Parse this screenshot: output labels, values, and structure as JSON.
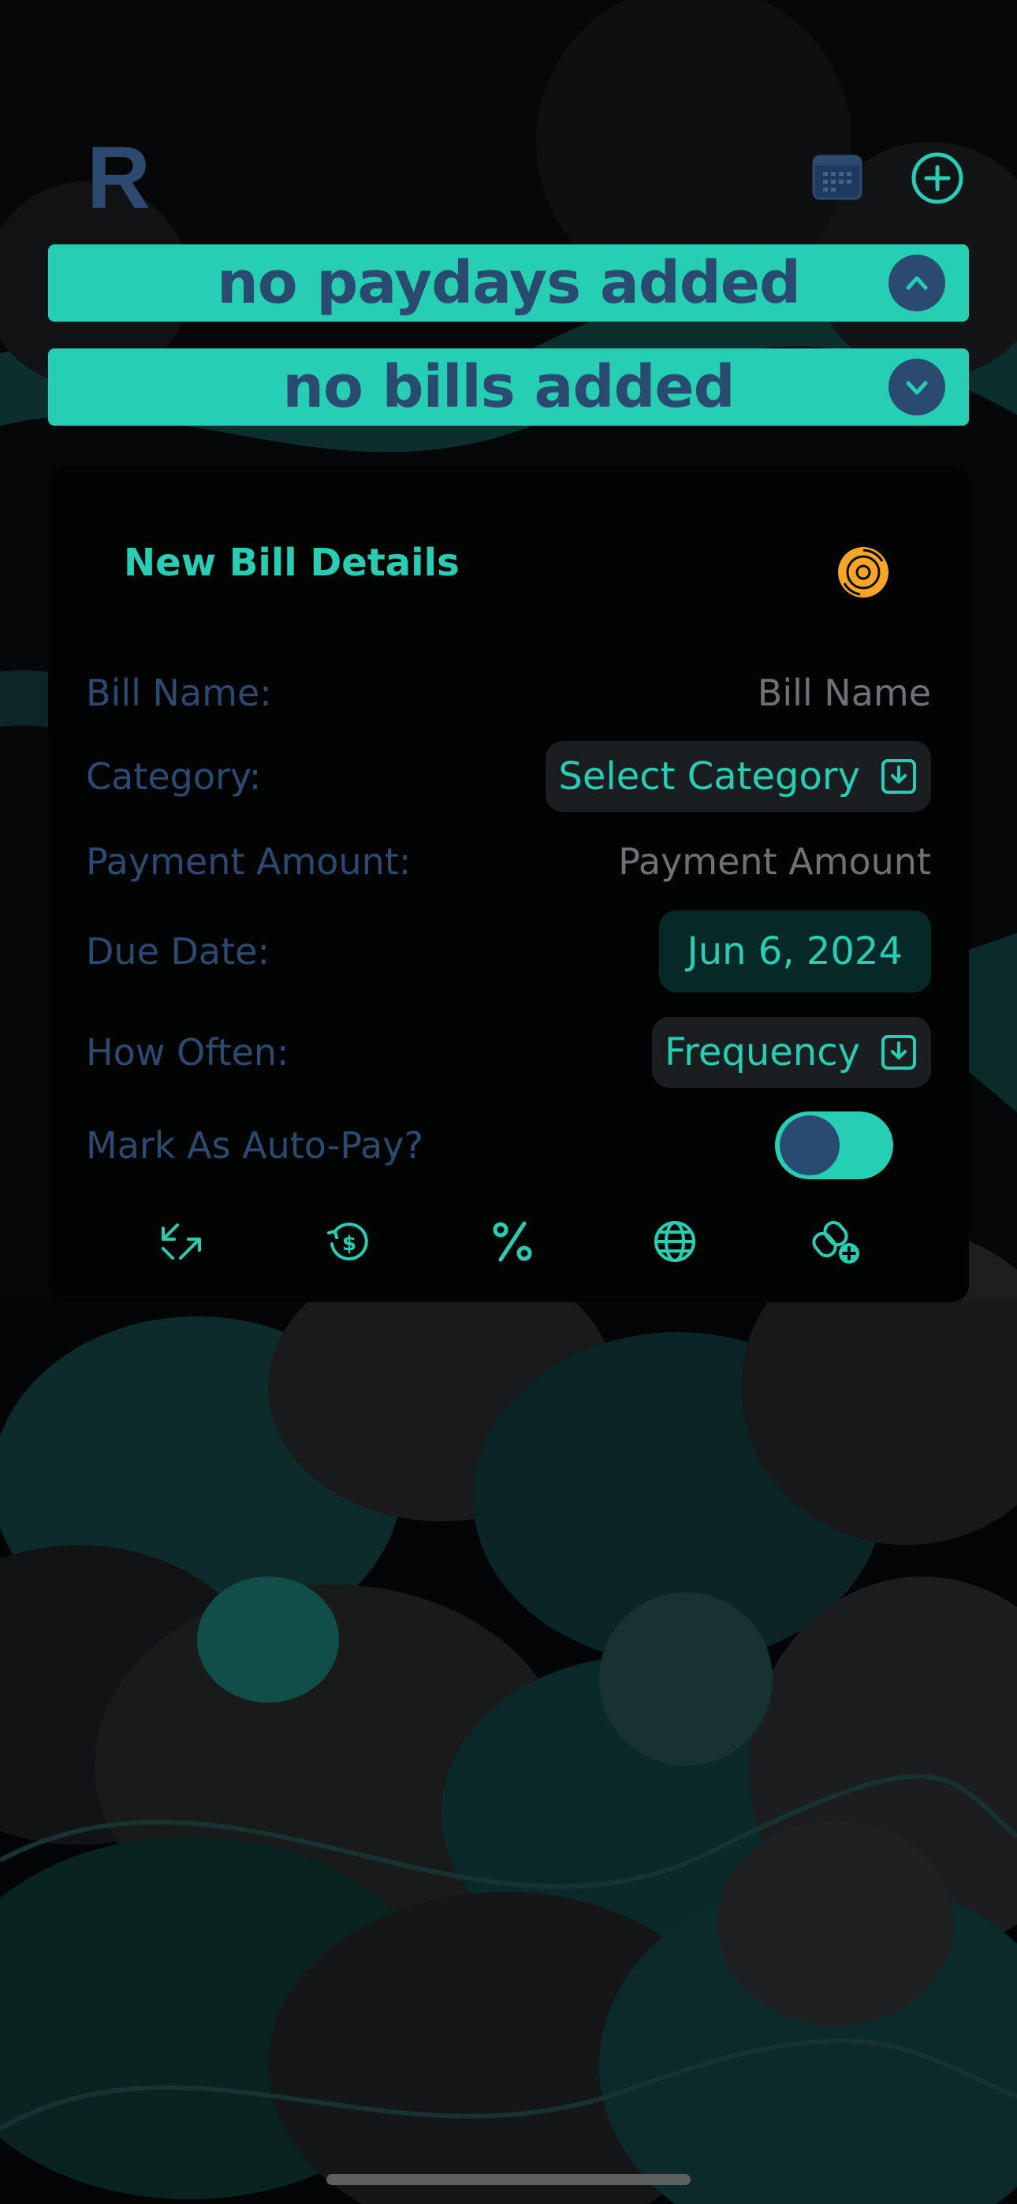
{
  "header": {
    "logo_letter": "R",
    "calendar_icon": "calendar-grid-icon",
    "add_icon": "plus-circle-icon"
  },
  "paydays_banner": {
    "text": "no paydays added",
    "toggle_icon": "chevron-up-icon"
  },
  "bills_banner": {
    "text": "no bills added",
    "toggle_icon": "chevron-down-icon"
  },
  "form": {
    "title": "New Bill Details",
    "header_icon": "disc-icon",
    "bill_name": {
      "label": "Bill Name:",
      "placeholder": "Bill Name"
    },
    "category": {
      "label": "Category:",
      "value": "Select Category",
      "icon": "dropdown-box-icon"
    },
    "payment_amount": {
      "label": "Payment Amount:",
      "placeholder": "Payment Amount"
    },
    "due_date": {
      "label": "Due Date:",
      "value": "Jun 6, 2024"
    },
    "how_often": {
      "label": "How Often:",
      "value": "Frequency",
      "icon": "dropdown-box-icon"
    },
    "auto_pay": {
      "label": "Mark As Auto-Pay?",
      "on": true
    },
    "toolbar_icons": [
      "expand-arrows-icon",
      "dollar-refresh-icon",
      "percent-icon",
      "globe-icon",
      "link-add-icon"
    ]
  },
  "colors": {
    "accent": "#26cfb3",
    "navy": "#2b4a70",
    "card": "#020404",
    "placeholder": "#6e7275",
    "disc": "#f5a623"
  }
}
